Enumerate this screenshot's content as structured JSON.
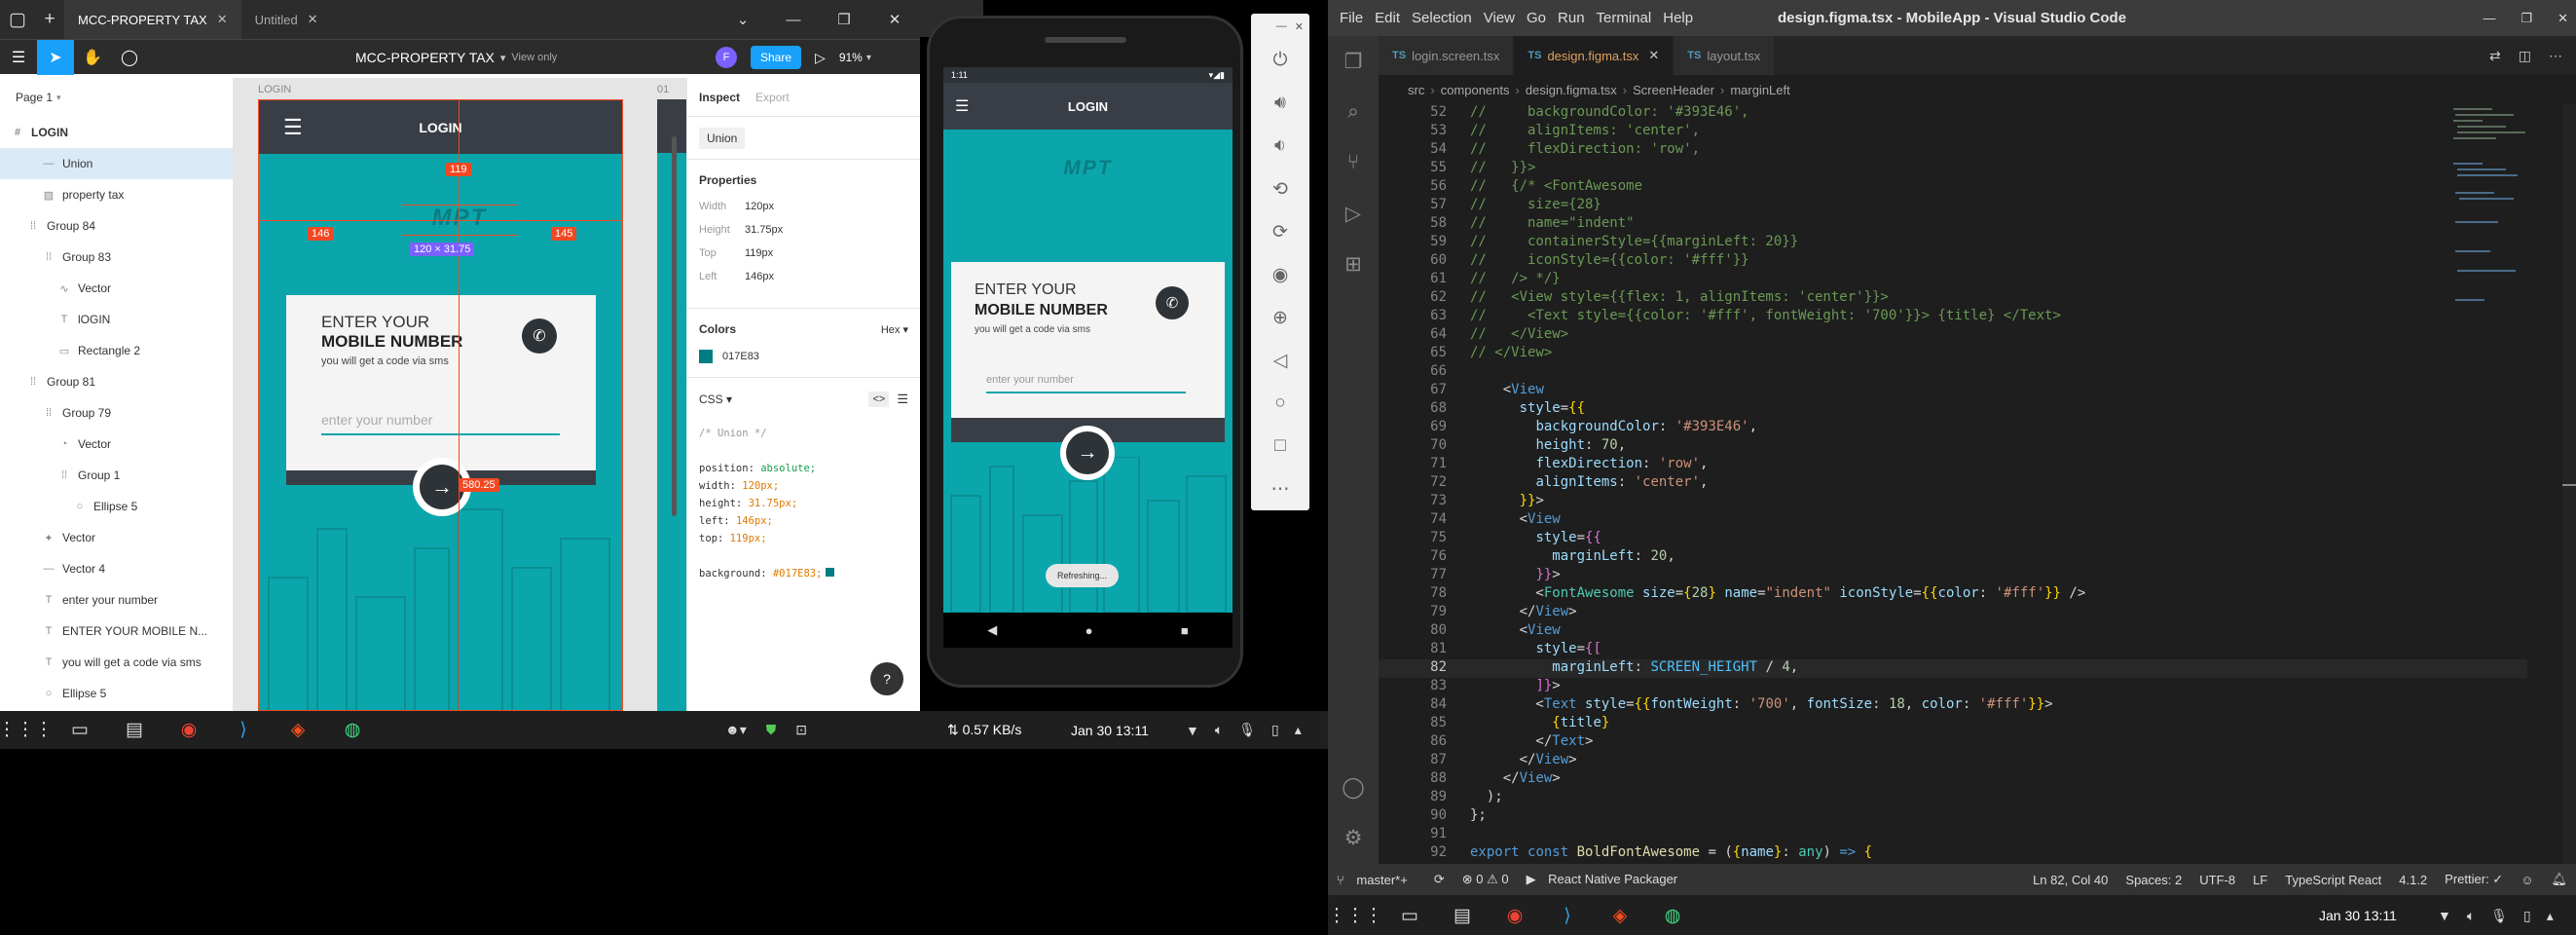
{
  "figma": {
    "tabs": [
      {
        "label": "MCC-PROPERTY TAX",
        "active": true
      },
      {
        "label": "Untitled",
        "active": false
      }
    ],
    "file_title": "MCC-PROPERTY TAX",
    "view_mode": "View only",
    "avatar": "F",
    "share": "Share",
    "zoom": "91%",
    "page": "Page 1",
    "layers": [
      {
        "label": "LOGIN",
        "indent": 0,
        "icon": "#",
        "selected": false,
        "bold": true
      },
      {
        "label": "Union",
        "indent": 2,
        "icon": "—",
        "selected": true
      },
      {
        "label": "property tax",
        "indent": 2,
        "icon": "▨",
        "selected": false
      },
      {
        "label": "Group 84",
        "indent": 1,
        "icon": "⁞⁞",
        "selected": false
      },
      {
        "label": "Group 83",
        "indent": 2,
        "icon": "⁞⁞",
        "selected": false
      },
      {
        "label": "Vector",
        "indent": 3,
        "icon": "∿",
        "selected": false
      },
      {
        "label": "lOGIN",
        "indent": 3,
        "icon": "T",
        "selected": false
      },
      {
        "label": "Rectangle 2",
        "indent": 3,
        "icon": "▭",
        "selected": false
      },
      {
        "label": "Group 81",
        "indent": 1,
        "icon": "⁞⁞",
        "selected": false
      },
      {
        "label": "Group 79",
        "indent": 2,
        "icon": "⁞⁞",
        "selected": false
      },
      {
        "label": "Vector",
        "indent": 3,
        "icon": "◔",
        "selected": false
      },
      {
        "label": "Group 1",
        "indent": 3,
        "icon": "⁞⁞",
        "selected": false
      },
      {
        "label": "Ellipse 5",
        "indent": 4,
        "icon": "○",
        "selected": false
      },
      {
        "label": "Vector",
        "indent": 2,
        "icon": "✦",
        "selected": false
      },
      {
        "label": "Vector 4",
        "indent": 2,
        "icon": "—",
        "selected": false
      },
      {
        "label": "enter your number",
        "indent": 2,
        "icon": "T",
        "selected": false
      },
      {
        "label": "ENTER YOUR MOBILE N...",
        "indent": 2,
        "icon": "T",
        "selected": false
      },
      {
        "label": "you will get a code via sms",
        "indent": 2,
        "icon": "T",
        "selected": false
      },
      {
        "label": "Ellipse 5",
        "indent": 2,
        "icon": "○",
        "selected": false
      }
    ],
    "canvas": {
      "frame_label": "LOGIN",
      "frame2_label": "01",
      "header_title": "LOGIN",
      "logo_text": "MPT",
      "card_title_1": "ENTER YOUR",
      "card_title_2": "MOBILE NUMBER",
      "card_sub": "you will get a code via sms",
      "input_placeholder": "enter your number",
      "m_top": "119",
      "m_left": "146",
      "m_right": "145",
      "m_size": "120 × 31.75",
      "m_button": "580.25"
    },
    "inspect": {
      "tab_inspect": "Inspect",
      "tab_export": "Export",
      "layer_name": "Union",
      "properties_title": "Properties",
      "props": [
        {
          "k": "Width",
          "v": "120px"
        },
        {
          "k": "Height",
          "v": "31.75px"
        },
        {
          "k": "Top",
          "v": "119px"
        },
        {
          "k": "Left",
          "v": "146px"
        }
      ],
      "colors_title": "Colors",
      "color_format": "Hex",
      "color_value": "017E83",
      "css_title": "CSS",
      "css_lines": [
        {
          "p": "/* Union */",
          "c": "cm"
        },
        {
          "p": "",
          "c": ""
        },
        {
          "p": "position: ",
          "v": "absolute;",
          "c": "g"
        },
        {
          "p": "width: ",
          "v": "120px;",
          "c": "o"
        },
        {
          "p": "height: ",
          "v": "31.75px;",
          "c": "o"
        },
        {
          "p": "left: ",
          "v": "146px;",
          "c": "o"
        },
        {
          "p": "top: ",
          "v": "119px;",
          "c": "o"
        },
        {
          "p": "",
          "c": ""
        },
        {
          "p": "background: ",
          "v": "#017E83;",
          "c": "o"
        }
      ],
      "help": "?"
    }
  },
  "phone": {
    "status_time": "1:11",
    "header_title": "LOGIN",
    "logo_text": "MPT",
    "card_title_1": "ENTER YOUR",
    "card_title_2": "MOBILE NUMBER",
    "card_sub": "you will get a code via sms",
    "input_placeholder": "enter your number",
    "toast": "Refreshing..."
  },
  "left_taskbar": {
    "net": "⇅ 0.57 KB/s",
    "date": "Jan 30  13:11"
  },
  "vscode": {
    "window_title": "design.figma.tsx - MobileApp - Visual Studio Code",
    "menu": [
      "File",
      "Edit",
      "Selection",
      "View",
      "Go",
      "Run",
      "Terminal",
      "Help"
    ],
    "tabs": [
      {
        "label": "login.screen.tsx",
        "active": false
      },
      {
        "label": "design.figma.tsx",
        "active": true
      },
      {
        "label": "layout.tsx",
        "active": false
      }
    ],
    "breadcrumb": [
      "src",
      "components",
      "design.figma.tsx",
      "ScreenHeader",
      "marginLeft"
    ],
    "status": {
      "branch": "master*+",
      "problems": "⊗ 0 ⚠ 0",
      "packager": "React Native Packager",
      "position": "Ln 82, Col 40",
      "spaces": "Spaces: 2",
      "encoding": "UTF-8",
      "eol": "LF",
      "lang": "TypeScript React",
      "version": "4.1.2",
      "prettier": "Prettier: ✓"
    },
    "taskbar_date": "Jan 30  13:11"
  },
  "code_lines": [
    {
      "n": "52",
      "h": [
        [
          "cm",
          "//     backgroundColor: '#393E46',"
        ]
      ]
    },
    {
      "n": "53",
      "h": [
        [
          "cm",
          "//     alignItems: 'center',"
        ]
      ]
    },
    {
      "n": "54",
      "h": [
        [
          "cm",
          "//     flexDirection: 'row',"
        ]
      ]
    },
    {
      "n": "55",
      "h": [
        [
          "cm",
          "//   }}>"
        ]
      ]
    },
    {
      "n": "56",
      "h": [
        [
          "cm",
          "//   {/* <FontAwesome"
        ]
      ]
    },
    {
      "n": "57",
      "h": [
        [
          "cm",
          "//     size={28}"
        ]
      ]
    },
    {
      "n": "58",
      "h": [
        [
          "cm",
          "//     name=\"indent\""
        ]
      ]
    },
    {
      "n": "59",
      "h": [
        [
          "cm",
          "//     containerStyle={{marginLeft: 20}}"
        ]
      ]
    },
    {
      "n": "60",
      "h": [
        [
          "cm",
          "//     iconStyle={{color: '#fff'}}"
        ]
      ]
    },
    {
      "n": "61",
      "h": [
        [
          "cm",
          "//   /> */}"
        ]
      ]
    },
    {
      "n": "62",
      "h": [
        [
          "cm",
          "//   <View style={{flex: 1, alignItems: 'center'}}>"
        ]
      ]
    },
    {
      "n": "63",
      "h": [
        [
          "cm",
          "//     <Text style={{color: '#fff', fontWeight: '700'}}> {title} </Text>"
        ]
      ]
    },
    {
      "n": "64",
      "h": [
        [
          "cm",
          "//   </View>"
        ]
      ]
    },
    {
      "n": "65",
      "h": [
        [
          "cm",
          "// </View>"
        ]
      ]
    },
    {
      "n": "66",
      "h": [
        [
          "pu",
          ""
        ]
      ]
    },
    {
      "n": "67",
      "h": [
        [
          "pu",
          "    "
        ],
        [
          "pu",
          "<"
        ],
        [
          "tg",
          "View"
        ]
      ]
    },
    {
      "n": "68",
      "h": [
        [
          "pu",
          "      "
        ],
        [
          "at",
          "style"
        ],
        [
          "pu",
          "="
        ],
        [
          "br",
          "{{"
        ]
      ]
    },
    {
      "n": "69",
      "h": [
        [
          "pu",
          "        "
        ],
        [
          "at",
          "backgroundColor"
        ],
        [
          "pu",
          ": "
        ],
        [
          "st",
          "'#393E46'"
        ],
        [
          "pu",
          ","
        ]
      ]
    },
    {
      "n": "70",
      "h": [
        [
          "pu",
          "        "
        ],
        [
          "at",
          "height"
        ],
        [
          "pu",
          ": "
        ],
        [
          "nu",
          "70"
        ],
        [
          "pu",
          ","
        ]
      ]
    },
    {
      "n": "71",
      "h": [
        [
          "pu",
          "        "
        ],
        [
          "at",
          "flexDirection"
        ],
        [
          "pu",
          ": "
        ],
        [
          "st",
          "'row'"
        ],
        [
          "pu",
          ","
        ]
      ]
    },
    {
      "n": "72",
      "h": [
        [
          "pu",
          "        "
        ],
        [
          "at",
          "alignItems"
        ],
        [
          "pu",
          ": "
        ],
        [
          "st",
          "'center'"
        ],
        [
          "pu",
          ","
        ]
      ]
    },
    {
      "n": "73",
      "h": [
        [
          "pu",
          "      "
        ],
        [
          "br",
          "}}"
        ],
        [
          "pu",
          ">"
        ]
      ]
    },
    {
      "n": "74",
      "h": [
        [
          "pu",
          "      <"
        ],
        [
          "tg",
          "View"
        ]
      ]
    },
    {
      "n": "75",
      "h": [
        [
          "pu",
          "        "
        ],
        [
          "at",
          "style"
        ],
        [
          "pu",
          "="
        ],
        [
          "br2",
          "{{"
        ]
      ]
    },
    {
      "n": "76",
      "h": [
        [
          "pu",
          "          "
        ],
        [
          "at",
          "marginLeft"
        ],
        [
          "pu",
          ": "
        ],
        [
          "nu",
          "20"
        ],
        [
          "pu",
          ","
        ]
      ]
    },
    {
      "n": "77",
      "h": [
        [
          "pu",
          "        "
        ],
        [
          "br2",
          "}}"
        ],
        [
          "pu",
          ">"
        ]
      ]
    },
    {
      "n": "78",
      "h": [
        [
          "pu",
          "        <"
        ],
        [
          "ty",
          "FontAwesome"
        ],
        [
          "pu",
          " "
        ],
        [
          "at",
          "size"
        ],
        [
          "pu",
          "="
        ],
        [
          "br",
          "{"
        ],
        [
          "nu",
          "28"
        ],
        [
          "br",
          "}"
        ],
        [
          "pu",
          " "
        ],
        [
          "at",
          "name"
        ],
        [
          "pu",
          "="
        ],
        [
          "st",
          "\"indent\""
        ],
        [
          "pu",
          " "
        ],
        [
          "at",
          "iconStyle"
        ],
        [
          "pu",
          "="
        ],
        [
          "br",
          "{{"
        ],
        [
          "at",
          "color"
        ],
        [
          "pu",
          ": "
        ],
        [
          "st",
          "'#fff'"
        ],
        [
          "br",
          "}}"
        ],
        [
          "pu",
          " />"
        ]
      ]
    },
    {
      "n": "79",
      "h": [
        [
          "pu",
          "      </"
        ],
        [
          "tg",
          "View"
        ],
        [
          "pu",
          ">"
        ]
      ]
    },
    {
      "n": "80",
      "h": [
        [
          "pu",
          "      <"
        ],
        [
          "tg",
          "View"
        ]
      ]
    },
    {
      "n": "81",
      "h": [
        [
          "pu",
          "        "
        ],
        [
          "at",
          "style"
        ],
        [
          "pu",
          "="
        ],
        [
          "br2",
          "{["
        ]
      ]
    },
    {
      "n": "82",
      "h": [
        [
          "pu",
          "          "
        ],
        [
          "at",
          "marginLeft"
        ],
        [
          "pu",
          ": "
        ],
        [
          "cn",
          "SCREEN_HEIGHT"
        ],
        [
          "pu",
          " / "
        ],
        [
          "nu",
          "4"
        ],
        [
          "pu",
          ","
        ]
      ],
      "cur": true
    },
    {
      "n": "83",
      "h": [
        [
          "pu",
          "        "
        ],
        [
          "br2",
          "]}"
        ],
        [
          "pu",
          ">"
        ]
      ]
    },
    {
      "n": "84",
      "h": [
        [
          "pu",
          "        <"
        ],
        [
          "tg",
          "Text"
        ],
        [
          "pu",
          " "
        ],
        [
          "at",
          "style"
        ],
        [
          "pu",
          "="
        ],
        [
          "br",
          "{{"
        ],
        [
          "at",
          "fontWeight"
        ],
        [
          "pu",
          ": "
        ],
        [
          "st",
          "'700'"
        ],
        [
          "pu",
          ", "
        ],
        [
          "at",
          "fontSize"
        ],
        [
          "pu",
          ": "
        ],
        [
          "nu",
          "18"
        ],
        [
          "pu",
          ", "
        ],
        [
          "at",
          "color"
        ],
        [
          "pu",
          ": "
        ],
        [
          "st",
          "'#fff'"
        ],
        [
          "br",
          "}}"
        ],
        [
          "pu",
          ">"
        ]
      ]
    },
    {
      "n": "85",
      "h": [
        [
          "pu",
          "          "
        ],
        [
          "br",
          "{"
        ],
        [
          "at",
          "title"
        ],
        [
          "br",
          "}"
        ]
      ]
    },
    {
      "n": "86",
      "h": [
        [
          "pu",
          "        </"
        ],
        [
          "tg",
          "Text"
        ],
        [
          "pu",
          ">"
        ]
      ]
    },
    {
      "n": "87",
      "h": [
        [
          "pu",
          "      </"
        ],
        [
          "tg",
          "View"
        ],
        [
          "pu",
          ">"
        ]
      ]
    },
    {
      "n": "88",
      "h": [
        [
          "pu",
          "    </"
        ],
        [
          "tg",
          "View"
        ],
        [
          "pu",
          ">"
        ]
      ]
    },
    {
      "n": "89",
      "h": [
        [
          "pu",
          "  );"
        ]
      ]
    },
    {
      "n": "90",
      "h": [
        [
          "pu",
          "};"
        ]
      ]
    },
    {
      "n": "91",
      "h": [
        [
          "pu",
          ""
        ]
      ]
    },
    {
      "n": "92",
      "h": [
        [
          "kw",
          "export"
        ],
        [
          "pu",
          " "
        ],
        [
          "kw",
          "const"
        ],
        [
          "pu",
          " "
        ],
        [
          "fn",
          "BoldFontAwesome"
        ],
        [
          "pu",
          " = ("
        ],
        [
          "br",
          "{"
        ],
        [
          "at",
          "name"
        ],
        [
          "br",
          "}"
        ],
        [
          "pu",
          ": "
        ],
        [
          "ty",
          "any"
        ],
        [
          "pu",
          ") "
        ],
        [
          "kw",
          "=>"
        ],
        [
          "pu",
          " "
        ],
        [
          "br",
          "{"
        ]
      ]
    }
  ]
}
